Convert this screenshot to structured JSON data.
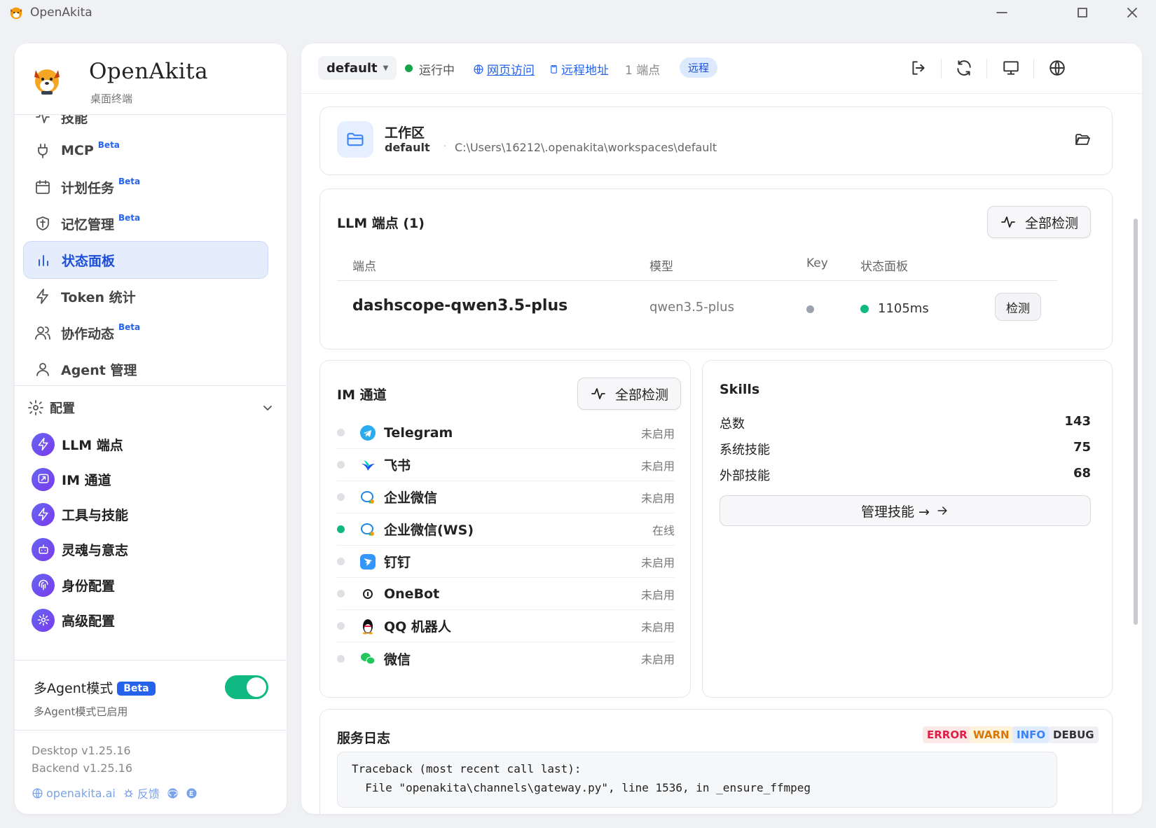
{
  "window": {
    "title": "OpenAkita"
  },
  "brand": {
    "name": "OpenAkita",
    "subtitle": "桌面终端"
  },
  "nav": {
    "items": [
      {
        "label": "技能",
        "icon": "skills-icon",
        "beta": ""
      },
      {
        "label": "MCP",
        "icon": "plug-icon",
        "beta": "Beta"
      },
      {
        "label": "计划任务",
        "icon": "calendar-icon",
        "beta": "Beta"
      },
      {
        "label": "记忆管理",
        "icon": "brain-shield-icon",
        "beta": "Beta"
      },
      {
        "label": "状态面板",
        "icon": "bar-chart-icon",
        "beta": "",
        "active": true
      },
      {
        "label": "Token 统计",
        "icon": "bolt-icon",
        "beta": ""
      },
      {
        "label": "协作动态",
        "icon": "users-icon",
        "beta": "Beta"
      },
      {
        "label": "Agent 管理",
        "icon": "agent-icon",
        "beta": ""
      }
    ]
  },
  "config": {
    "header": "配置",
    "items": [
      {
        "label": "LLM 端点",
        "icon": "bolt-icon"
      },
      {
        "label": "IM 通道",
        "icon": "message-icon"
      },
      {
        "label": "工具与技能",
        "icon": "bolt-icon"
      },
      {
        "label": "灵魂与意志",
        "icon": "robot-icon"
      },
      {
        "label": "身份配置",
        "icon": "fingerprint-icon"
      },
      {
        "label": "高级配置",
        "icon": "gear-icon"
      }
    ]
  },
  "multi_agent": {
    "label": "多Agent模式",
    "beta": "Beta",
    "status": "多Agent模式已启用",
    "enabled": true
  },
  "versions": {
    "desktop": "Desktop v1.25.16",
    "backend": "Backend v1.25.16"
  },
  "footer_links": {
    "site": "openakita.ai",
    "feedback": "反馈"
  },
  "topbar": {
    "workspace": "default",
    "status": "运行中",
    "web_access": "网页访问",
    "remote_address": "远程地址",
    "endpoints": "1 端点",
    "remote_badge": "远程"
  },
  "workspace_card": {
    "title": "工作区",
    "name": "default",
    "separator": "·",
    "path": "C:\\Users\\16212\\.openakita\\workspaces\\default"
  },
  "llm": {
    "title": "LLM 端点 (1)",
    "check_all": "全部检测",
    "headers": {
      "endpoint": "端点",
      "model": "模型",
      "key": "Key",
      "status": "状态面板"
    },
    "rows": [
      {
        "endpoint": "dashscope-qwen3.5-plus",
        "model": "qwen3.5-plus",
        "latency": "1105ms",
        "check": "检测"
      }
    ]
  },
  "im": {
    "title": "IM 通道",
    "check_all": "全部检测",
    "channels": [
      {
        "name": "Telegram",
        "status": "未启用",
        "online": false,
        "icon": "telegram-icon"
      },
      {
        "name": "飞书",
        "status": "未启用",
        "online": false,
        "icon": "feishu-icon"
      },
      {
        "name": "企业微信",
        "status": "未启用",
        "online": false,
        "icon": "wecom-icon"
      },
      {
        "name": "企业微信(WS)",
        "status": "在线",
        "online": true,
        "icon": "wecom-icon"
      },
      {
        "name": "钉钉",
        "status": "未启用",
        "online": false,
        "icon": "dingtalk-icon"
      },
      {
        "name": "OneBot",
        "status": "未启用",
        "online": false,
        "icon": "onebot-icon"
      },
      {
        "name": "QQ 机器人",
        "status": "未启用",
        "online": false,
        "icon": "qq-icon"
      },
      {
        "name": "微信",
        "status": "未启用",
        "online": false,
        "icon": "wechat-icon"
      }
    ]
  },
  "skills": {
    "title": "Skills",
    "rows": [
      {
        "label": "总数",
        "value": "143"
      },
      {
        "label": "系统技能",
        "value": "75"
      },
      {
        "label": "外部技能",
        "value": "68"
      }
    ],
    "manage": "管理技能 →"
  },
  "logs": {
    "title": "服务日志",
    "levels": [
      "ERROR",
      "WARN",
      "INFO",
      "DEBUG"
    ],
    "lines": [
      "Traceback (most recent call last):",
      "  File \"openakita\\channels\\gateway.py\", line 1536, in _ensure_ffmpeg"
    ]
  },
  "colors": {
    "accent": "#2563eb",
    "online": "#10b981",
    "active_bg": "#e5edfc"
  }
}
